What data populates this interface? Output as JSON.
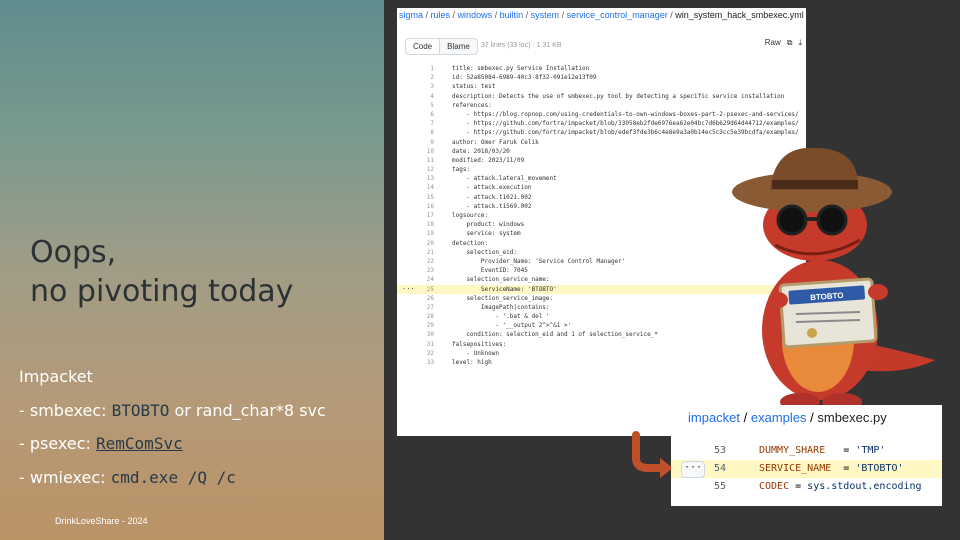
{
  "slide": {
    "title_line1": "Oops,",
    "title_line2": "no pivoting today",
    "section_label": "Impacket",
    "bullets": [
      {
        "prefix": "- smbexec: ",
        "code": "BTOBTO",
        "suffix": " or rand_char*8 svc"
      },
      {
        "prefix": "- psexec: ",
        "code": "RemComSvc",
        "suffix": ""
      },
      {
        "prefix": "- wmiexec: ",
        "code": "cmd.exe /Q /c",
        "suffix": ""
      }
    ],
    "footer": "DrinkLoveShare - 2024"
  },
  "sigma_panel": {
    "breadcrumb": [
      "sigma",
      "rules",
      "windows",
      "builtin",
      "system",
      "service_control_manager",
      "win_system_hack_smbexec.yml"
    ],
    "tabs": [
      "Code",
      "Blame"
    ],
    "meta": "37 lines (33 loc) · 1.31 KB",
    "raw_label": "Raw",
    "lines": [
      {
        "n": "1",
        "t": "title: smbexec.py Service Installation"
      },
      {
        "n": "2",
        "t": "id: 52a85084-6989-40c3-8f32-091e12e13f09"
      },
      {
        "n": "3",
        "t": "status: test"
      },
      {
        "n": "4",
        "t": "description: Detects the use of smbexec.py tool by detecting a specific service installation"
      },
      {
        "n": "5",
        "t": "references:"
      },
      {
        "n": "6",
        "t": "    - https://blog.ropnop.com/using-credentials-to-own-windows-boxes-part-2-psexec-and-services/"
      },
      {
        "n": "7",
        "t": "    - https://github.com/fortra/impacket/blob/33058eb2fde6976ea62e04bc7d6b629d64d44712/examples/"
      },
      {
        "n": "8",
        "t": "    - https://github.com/fortra/impacket/blob/edef3fde3b6c4e8e9a3a0b14ec5c3cc5e39bcdfa/examples/"
      },
      {
        "n": "9",
        "t": "author: Omer Faruk Celik"
      },
      {
        "n": "10",
        "t": "date: 2018/03/20"
      },
      {
        "n": "11",
        "t": "modified: 2023/11/09"
      },
      {
        "n": "12",
        "t": "tags:"
      },
      {
        "n": "13",
        "t": "    - attack.lateral_movement"
      },
      {
        "n": "14",
        "t": "    - attack.execution"
      },
      {
        "n": "15",
        "t": "    - attack.t1021.002"
      },
      {
        "n": "16",
        "t": "    - attack.t1569.002"
      },
      {
        "n": "17",
        "t": "logsource:"
      },
      {
        "n": "18",
        "t": "    product: windows"
      },
      {
        "n": "19",
        "t": "    service: system"
      },
      {
        "n": "20",
        "t": "detection:"
      },
      {
        "n": "21",
        "t": "    selection_eid:"
      },
      {
        "n": "22",
        "t": "        Provider_Name: 'Service Control Manager'"
      },
      {
        "n": "23",
        "t": "        EventID: 7045"
      },
      {
        "n": "24",
        "t": "    selection_service_name:"
      },
      {
        "n": "25",
        "t": "        ServiceName: 'BTOBTO'"
      },
      {
        "n": "26",
        "t": "    selection_service_image:"
      },
      {
        "n": "27",
        "t": "        ImagePath|contains:"
      },
      {
        "n": "28",
        "t": "            - '.bat & del '"
      },
      {
        "n": "29",
        "t": "            - '__output 2^>^&1 >'"
      },
      {
        "n": "30",
        "t": "    condition: selection_eid and 1 of selection_service_*"
      },
      {
        "n": "31",
        "t": "falsepositives:"
      },
      {
        "n": "32",
        "t": "    - Unknown"
      },
      {
        "n": "33",
        "t": "level: high"
      }
    ],
    "highlight_line": "25"
  },
  "badge_text": "BTOBTO",
  "impacket_panel": {
    "breadcrumb": [
      "impacket",
      "examples",
      "smbexec.py"
    ],
    "rows": [
      {
        "n": "53",
        "k": "DUMMY_SHARE",
        "eq": "   = ",
        "v": "'TMP'"
      },
      {
        "n": "54",
        "k": "SERVICE_NAME",
        "eq": "  = ",
        "v": "'BTOBTO'"
      },
      {
        "n": "55",
        "k": "CODEC",
        "eq": " = ",
        "v": "sys.stdout.encoding"
      }
    ],
    "highlight_row": "54"
  },
  "colors": {
    "accent": "#1f6feb",
    "highlight": "#fff8c5",
    "arrow": "#c0502a"
  }
}
